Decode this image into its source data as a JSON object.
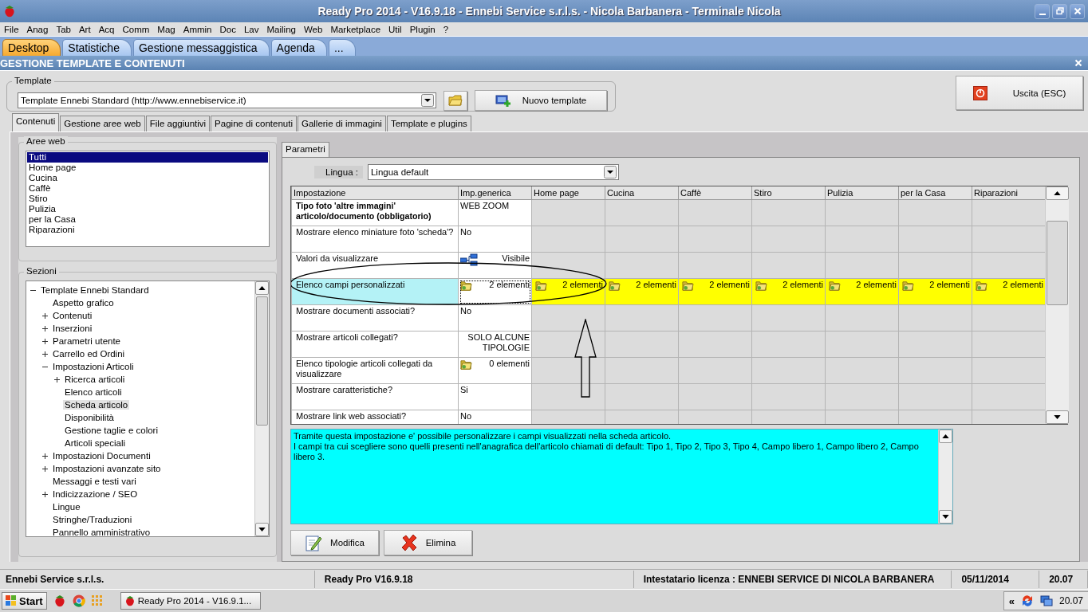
{
  "window": {
    "title": "Ready Pro 2014 - V16.9.18 - Ennebi Service s.r.l.s. - Nicola Barbanera - Terminale Nicola"
  },
  "menu": [
    "File",
    "Anag",
    "Tab",
    "Art",
    "Acq",
    "Comm",
    "Mag",
    "Ammin",
    "Doc",
    "Lav",
    "Mailing",
    "Web",
    "Marketplace",
    "Util",
    "Plugin",
    "?"
  ],
  "app_tabs": [
    {
      "label": "Desktop",
      "selected": true
    },
    {
      "label": "Statistiche",
      "selected": false
    },
    {
      "label": "Gestione messaggistica",
      "selected": false
    },
    {
      "label": "Agenda",
      "selected": false
    },
    {
      "label": "...",
      "selected": false
    }
  ],
  "module": {
    "title": "GESTIONE TEMPLATE E CONTENUTI"
  },
  "template": {
    "label": "Template",
    "value": "Template Ennebi Standard (http://www.ennebiservice.it)",
    "new_button": "Nuovo template"
  },
  "exit_button": "Uscita (ESC)",
  "tabs": [
    {
      "label": "Contenuti",
      "selected": true
    },
    {
      "label": "Gestione aree web",
      "selected": false
    },
    {
      "label": "File aggiuntivi",
      "selected": false
    },
    {
      "label": "Pagine di contenuti",
      "selected": false
    },
    {
      "label": "Gallerie di immagini",
      "selected": false
    },
    {
      "label": "Template e plugins",
      "selected": false
    }
  ],
  "web_areas": {
    "title": "Aree web",
    "items": [
      {
        "label": "Tutti",
        "selected": true
      },
      {
        "label": "Home page",
        "selected": false
      },
      {
        "label": "Cucina",
        "selected": false
      },
      {
        "label": "Caffè",
        "selected": false
      },
      {
        "label": "Stiro",
        "selected": false
      },
      {
        "label": "Pulizia",
        "selected": false
      },
      {
        "label": "per la Casa",
        "selected": false
      },
      {
        "label": "Riparazioni",
        "selected": false
      }
    ]
  },
  "sections": {
    "title": "Sezioni",
    "tree": [
      {
        "label": "Template Ennebi Standard",
        "expanded": true,
        "selected": false,
        "children": [
          {
            "label": "Aspetto grafico",
            "selected": false
          },
          {
            "label": "Contenuti",
            "expanded": false,
            "selected": false
          },
          {
            "label": "Inserzioni",
            "expanded": false,
            "selected": false
          },
          {
            "label": "Parametri utente",
            "expanded": false,
            "selected": false
          },
          {
            "label": "Carrello ed Ordini",
            "expanded": false,
            "selected": false
          },
          {
            "label": "Impostazioni Articoli",
            "expanded": true,
            "selected": false,
            "children": [
              {
                "label": "Ricerca articoli",
                "expanded": false,
                "selected": false
              },
              {
                "label": "Elenco articoli",
                "selected": false
              },
              {
                "label": "Scheda articolo",
                "selected": true
              },
              {
                "label": "Disponibilità",
                "selected": false
              },
              {
                "label": "Gestione taglie e colori",
                "selected": false
              },
              {
                "label": "Articoli speciali",
                "selected": false
              }
            ]
          },
          {
            "label": "Impostazioni Documenti",
            "expanded": false,
            "selected": false
          },
          {
            "label": "Impostazioni avanzate sito",
            "expanded": false,
            "selected": false
          },
          {
            "label": "Messaggi e testi vari",
            "selected": false
          },
          {
            "label": "Indicizzazione / SEO",
            "expanded": false,
            "selected": false
          },
          {
            "label": "Lingue",
            "selected": false
          },
          {
            "label": "Stringhe/Traduzioni",
            "selected": false
          },
          {
            "label": "Pannello amministrativo",
            "selected": false
          }
        ]
      }
    ]
  },
  "params": {
    "tab": "Parametri",
    "language_label": "Lingua :",
    "language": "Lingua default",
    "columns": [
      "Impostazione",
      "Imp.generica",
      "Home page",
      "Cucina",
      "Caffè",
      "Stiro",
      "Pulizia",
      "per la Casa",
      "Riparazioni"
    ],
    "rows": [
      {
        "kind": "text",
        "label": "Tipo foto 'altre immagini' articolo/documento (obbligatorio)",
        "required": true,
        "selected": false,
        "value": "WEB ZOOM"
      },
      {
        "kind": "text",
        "label": "Mostrare elenco miniature foto 'scheda'?",
        "required": false,
        "selected": false,
        "value": "No"
      },
      {
        "kind": "visibility",
        "label": "Valori da visualizzare",
        "required": false,
        "selected": false,
        "value": "Visibile"
      },
      {
        "kind": "list",
        "label": "Elenco campi personalizzati",
        "required": false,
        "selected": true,
        "value": "2 elementi",
        "area_values": [
          "2 elementi",
          "2 elementi",
          "2 elementi",
          "2 elementi",
          "2 elementi",
          "2 elementi",
          "2 elementi"
        ]
      },
      {
        "kind": "text",
        "label": "Mostrare documenti associati?",
        "required": false,
        "selected": false,
        "value": "No"
      },
      {
        "kind": "text",
        "label": "Mostrare articoli collegati?",
        "required": false,
        "selected": false,
        "value": "SOLO ALCUNE TIPOLOGIE"
      },
      {
        "kind": "list",
        "label": "Elenco tipologie articoli collegati da visualizzare",
        "required": false,
        "selected": false,
        "value": "0 elementi"
      },
      {
        "kind": "text",
        "label": "Mostrare caratteristiche?",
        "required": false,
        "selected": false,
        "value": "Si"
      },
      {
        "kind": "text",
        "label": "Mostrare link web associati?",
        "required": false,
        "selected": false,
        "value": "No"
      }
    ],
    "description": [
      "Tramite questa impostazione e' possibile personalizzare i campi visualizzati nella scheda articolo.",
      "I campi tra cui scegliere sono quelli presenti nell'anagrafica dell'articolo chiamati di default: Tipo 1, Tipo 2, Tipo 3, Tipo 4, Campo libero 1, Campo libero 2, Campo libero 3."
    ]
  },
  "buttons": [
    {
      "kind": "edit",
      "label": "Modifica"
    },
    {
      "kind": "delete",
      "label": "Elimina"
    }
  ],
  "status_bar": [
    "Ennebi Service s.r.l.s.",
    "Ready Pro V16.9.18",
    "Intestatario licenza : ENNEBI SERVICE DI NICOLA BARBANERA",
    "05/11/2014",
    "20.07"
  ],
  "taskbar": {
    "start": "Start",
    "task": "Ready Pro 2014 - V16.9.1...",
    "tray_expand": "«",
    "clock": "20.07"
  }
}
